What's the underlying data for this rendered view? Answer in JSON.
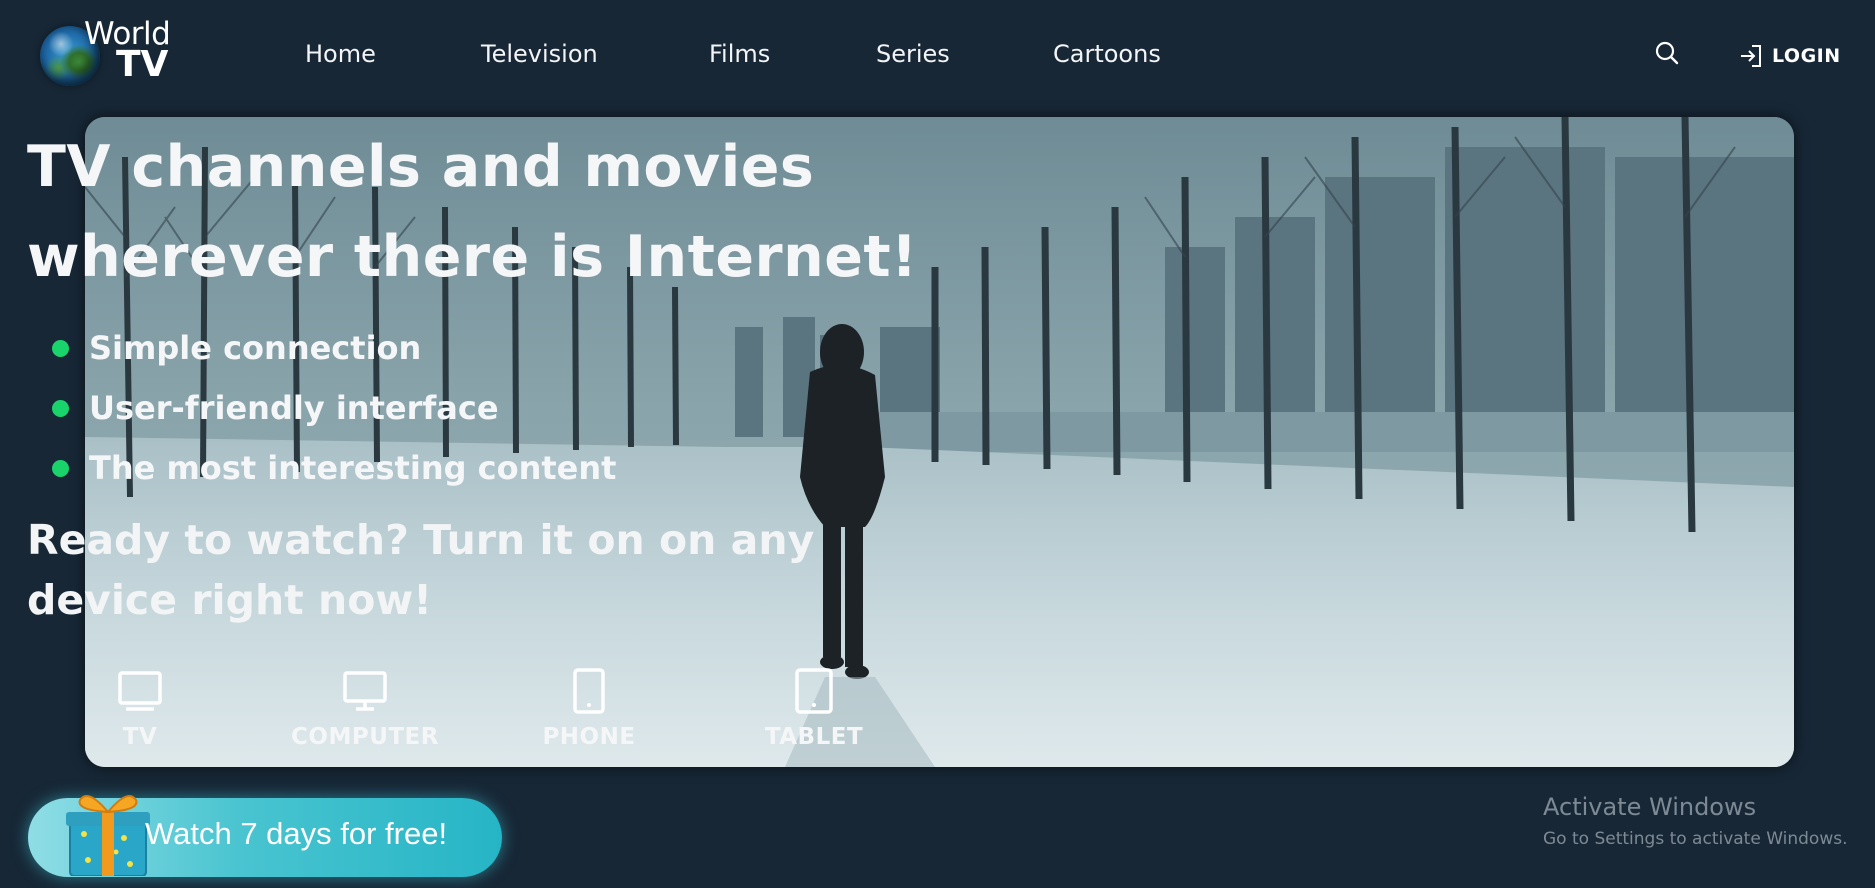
{
  "brand": {
    "world": "World",
    "tv": "TV"
  },
  "nav": [
    {
      "label": "Home"
    },
    {
      "label": "Television"
    },
    {
      "label": "Films"
    },
    {
      "label": "Series"
    },
    {
      "label": "Cartoons"
    }
  ],
  "header": {
    "search_icon": "search-icon",
    "login_label": "LOGIN",
    "login_icon": "sign-in-icon"
  },
  "hero": {
    "headline_line1": "TV channels and movies",
    "headline_line2": "wherever there is Internet!",
    "features": [
      "Simple connection",
      "User-friendly interface",
      "The most interesting content"
    ],
    "cta_line1": "Ready to watch? Turn it on on any",
    "cta_line2": "device right now!",
    "devices": [
      {
        "label": "TV",
        "icon": "tv-icon"
      },
      {
        "label": "COMPUTER",
        "icon": "desktop-icon"
      },
      {
        "label": "PHONE",
        "icon": "phone-icon"
      },
      {
        "label": "TABLET",
        "icon": "tablet-icon"
      }
    ]
  },
  "trial": {
    "label": "Watch 7 days for free!",
    "icon": "gift-icon"
  },
  "watermark": {
    "title": "Activate Windows",
    "subtitle": "Go to Settings to activate Windows."
  },
  "colors": {
    "background": "#172736",
    "accent_dot": "#19d36b",
    "trial_button": "#26b5c6"
  }
}
